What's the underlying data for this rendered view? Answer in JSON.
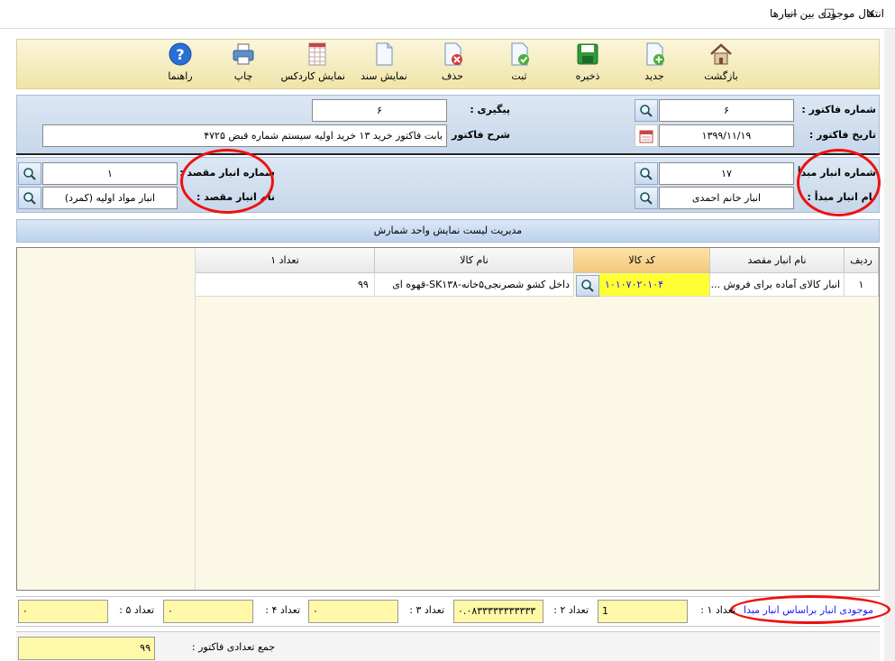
{
  "window": {
    "title": "انتقال موجودی بین انبارها",
    "minimize": "—",
    "maximize": "☐",
    "close": "✕"
  },
  "toolbar": {
    "back": "بازگشت",
    "new": "جدید",
    "save": "ذخیره",
    "register": "ثبت",
    "delete": "حذف",
    "show_doc": "نمایش سند",
    "show_cardex": "نمایش کاردکس",
    "print": "چاپ",
    "help": "راهنما"
  },
  "invoice": {
    "number_label": "شماره فاکتور :",
    "number_value": "۶",
    "date_label": "تاریخ فاکتور :",
    "date_value": "۱۳۹۹/۱۱/۱۹",
    "followup_label": "پیگیری :",
    "followup_value": "۶",
    "description_label": "شرح فاکتور :",
    "description_value": "بابت فاکتور خرید ۱۳ خرید اولیه سیستم شماره قبض ۴۷۲۵"
  },
  "warehouses": {
    "source_number_label": "شماره انبار مبدأ :",
    "source_number_value": "۱۷",
    "source_name_label": "نام انبار مبدأ :",
    "source_name_value": "انبار خانم احمدی",
    "dest_number_label": "شماره انبار مقصد :",
    "dest_number_value": "۱",
    "dest_name_label": "نام انبار مقصد :",
    "dest_name_value": "انبار مواد اولیه (کمرد)"
  },
  "management_bar": "مدیریت لیست نمایش واحد شمارش",
  "grid": {
    "headers": {
      "row": "ردیف",
      "dest_warehouse": "نام انبار مقصد",
      "code": "کد کالا",
      "name": "نام کالا",
      "qty1": "تعداد ۱"
    },
    "rows": [
      {
        "row": "۱",
        "dest_warehouse": "انبار کالای آماده برای فروش ...",
        "code": "۱۰۱۰۷۰۲۰۱۰۴",
        "name": "داخل کشو شصرنجی۵خانه-SK۱۳۸-قهوه ای",
        "qty1": "۹۹"
      }
    ]
  },
  "quantities": {
    "link": "موجودی انبار براساس انبار مبدا",
    "qty1_label": "تعداد ۱ :",
    "qty1_value": "1",
    "qty2_label": "تعداد ۲ :",
    "qty2_value": "۰.۰۸۳۳۳۳۳۳۳۳۳۳۳",
    "qty3_label": "تعداد ۳ :",
    "qty3_value": "۰",
    "qty4_label": "تعداد ۴ :",
    "qty4_value": "۰",
    "qty5_label": "تعداد ۵ :",
    "qty5_value": "۰"
  },
  "summary": {
    "total_label": "جمع تعدادی فاکتور :",
    "total_value": "۹۹"
  },
  "colors": {
    "toolbar_bg": "#f3ebbd",
    "panel_bg": "#cfdcec",
    "grid_bg": "#fbf9e6",
    "code_cell": "#ffff33",
    "highlight_ellipse": "#e11111",
    "link": "#1a1aff"
  }
}
